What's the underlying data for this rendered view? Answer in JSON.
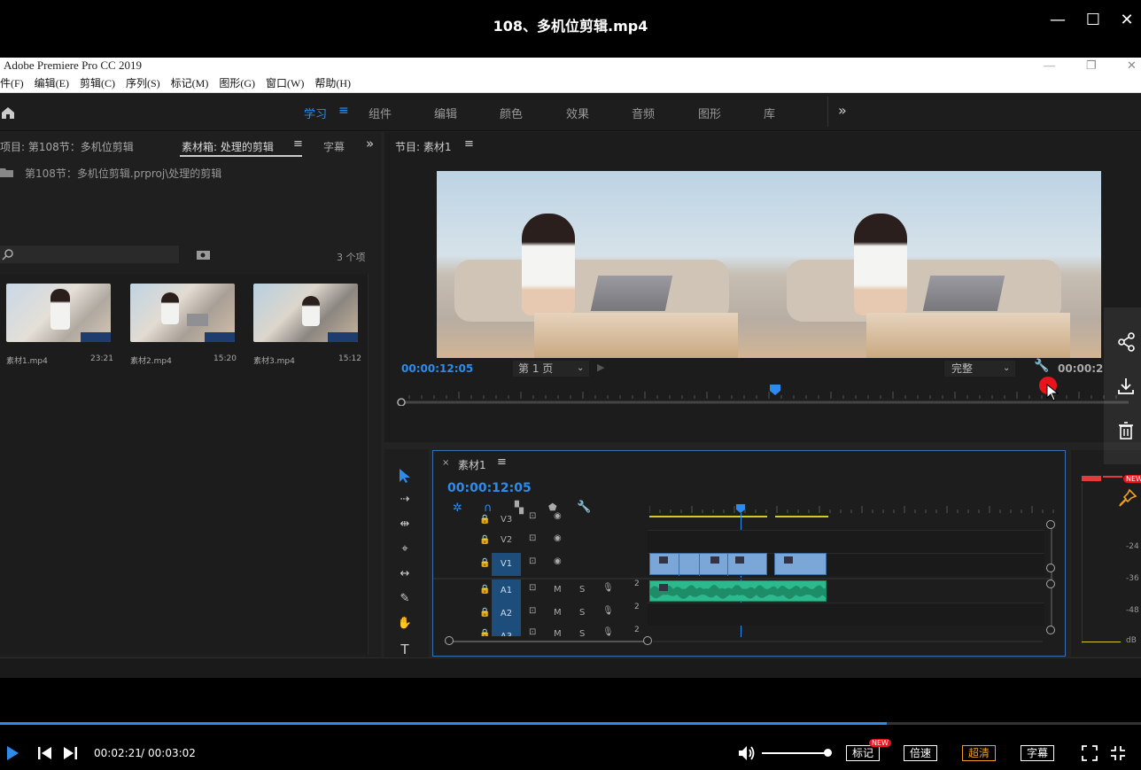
{
  "window": {
    "title": "108、多机位剪辑.mp4"
  },
  "app": {
    "title": "Adobe Premiere Pro CC 2019",
    "menu": [
      "件(F)",
      "编辑(E)",
      "剪辑(C)",
      "序列(S)",
      "标记(M)",
      "图形(G)",
      "窗口(W)",
      "帮助(H)"
    ],
    "workspaces": [
      "学习",
      "组件",
      "编辑",
      "颜色",
      "效果",
      "音频",
      "图形",
      "库"
    ],
    "active_workspace": "学习"
  },
  "project": {
    "tab1": "项目: 第108节：多机位剪辑",
    "tab2": "素材箱: 处理的剪辑",
    "tab3": "字幕",
    "path": "第108节：多机位剪辑.prproj\\处理的剪辑",
    "count": "3 个项",
    "items": [
      {
        "name": "素材1.mp4",
        "duration": "23:21"
      },
      {
        "name": "素材2.mp4",
        "duration": "15:20"
      },
      {
        "name": "素材3.mp4",
        "duration": "15:12"
      }
    ]
  },
  "program": {
    "tab": "节目: 素材1",
    "timecode": "00:00:12:05",
    "page": "第 1 页",
    "quality": "完整",
    "duration": "00:00:2"
  },
  "timeline": {
    "tab": "素材1",
    "timecode": "00:00:12:05",
    "video_tracks": [
      "V3",
      "V2",
      "V1"
    ],
    "audio_tracks": [
      "A1",
      "A2",
      "A3"
    ],
    "mute": "M",
    "solo": "S",
    "audio_level": "2"
  },
  "meter": {
    "ticks": [
      "-24",
      "-36",
      "-48",
      "dB"
    ],
    "new_badge": "NEW"
  },
  "player": {
    "current": "00:02:21",
    "separator": "/",
    "total": "00:03:02",
    "progress": 0.7773,
    "buttons": {
      "mark": "标记",
      "speed": "倍速",
      "hd": "超清",
      "subtitle": "字幕"
    },
    "mark_badge": "NEW"
  },
  "colors": {
    "accent": "#2d8ceb",
    "clip_video": "#7aa6d8",
    "clip_audio": "#2bb98d",
    "orange": "#f0a020"
  }
}
